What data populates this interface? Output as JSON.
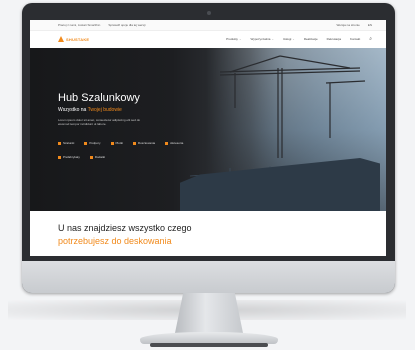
{
  "topbar": {
    "left_items": [
      "Pracuj z nami, zostań Smartfinn",
      "Sprawdź opcje dla tej wersji"
    ],
    "right_items": [
      "Wersja na stronie",
      "EN"
    ]
  },
  "logo": {
    "text": "SHUSTAKE"
  },
  "nav": {
    "items": [
      {
        "label": "Produkty",
        "arrow": "⌄"
      },
      {
        "label": "Wypożyczalnia",
        "arrow": "⌄"
      },
      {
        "label": "Usługi",
        "arrow": "⌄"
      },
      {
        "label": "Realizacje",
        "arrow": ""
      },
      {
        "label": "Rekrutacja",
        "arrow": ""
      },
      {
        "label": "Kontakt",
        "arrow": ""
      }
    ],
    "search_icon": "search-icon"
  },
  "hero": {
    "title": "Hub Szalunkowy",
    "subtitle_prefix": "Wszystko na ",
    "subtitle_highlight": "Twojej budowie",
    "description": "Lorem ipsum dolor sit amet, consectetur adipiscing elit sed do eiusmod tempor incididunt ut labore.",
    "categories": [
      "Szalunki",
      "Podpory",
      "Płotki",
      "Rusztowania",
      "Akcesoria",
      "Prefabrykaty",
      "Dodatki"
    ]
  },
  "section": {
    "line1": "U nas znajdziesz wszystko czego",
    "line2": "potrzebujesz do deskowania"
  },
  "colors": {
    "accent": "#f18a1c",
    "hero_dark": "#17181a"
  }
}
